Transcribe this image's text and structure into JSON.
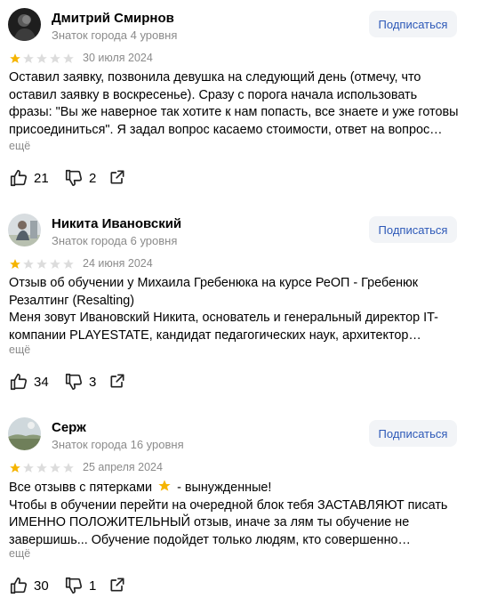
{
  "reviews": [
    {
      "name": "Дмитрий Смирнов",
      "level": "Знаток города 4 уровня",
      "subscribe": "Подписаться",
      "rating": 1,
      "date": "30 июля 2024",
      "lines": [
        "Оставил заявку, позвонила девушка на следующий день (отмечу, что",
        "оставил заявку в воскресенье). Сразу с порога начала использовать",
        "фразы: \"Вы же наверное так хотите к нам попасть, все знаете и уже готовы",
        "присоединиться\". Я задал вопрос касаемо стоимости, ответ на вопрос…"
      ],
      "more": "ещё",
      "likes": "21",
      "dislikes": "2"
    },
    {
      "name": "Никита Ивановский",
      "level": "Знаток города 6 уровня",
      "subscribe": "Подписаться",
      "rating": 1,
      "date": "24 июня 2024",
      "lines": [
        "Отзыв об обучении у Михаила Гребенюка на курсе РеОП - Гребенюк",
        "Резалтинг (Resalting)",
        "Меня зовут Ивановский Никита, основатель и генеральный директор IT-",
        "компании PLAYESTATE, кандидат педагогических наук, архитектор…"
      ],
      "more": "ещё",
      "likes": "34",
      "dislikes": "3"
    },
    {
      "name": "Серж",
      "level": "Знаток города 16 уровня",
      "subscribe": "Подписаться",
      "rating": 1,
      "date": "25 апреля 2024",
      "lines_first_a": "Все отзывв с пятерками",
      "lines_first_b": "- вынужденные!",
      "lines": [
        "Чтобы в обучении перейти на очередной блок тебя ЗАСТАВЛЯЮТ писать",
        "ИМЕННО ПОЛОЖИТЕЛЬНЫЙ отзыв, иначе за лям ты обучение не",
        "завершишь... Обучение подойдет только людям, кто совершенно…"
      ],
      "more": "ещё",
      "likes": "30",
      "dislikes": "1"
    }
  ],
  "colors": {
    "star_active": "#f5b400",
    "star_inactive": "#dcdcdc",
    "muted_text": "#8b8b8b",
    "subscribe_text": "#2d59b8",
    "subscribe_bg": "#f2f4f7"
  },
  "icons": [
    "like-icon",
    "dislike-icon",
    "share-icon",
    "star-icon",
    "star-emoji-icon"
  ]
}
